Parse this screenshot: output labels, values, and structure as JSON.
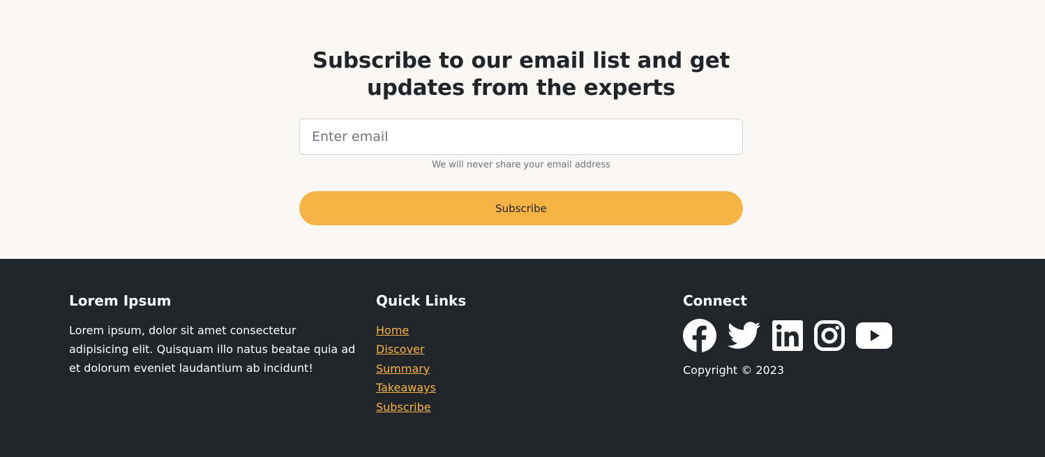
{
  "subscribe": {
    "title": "Subscribe to our email list and get updates from the experts",
    "email_placeholder": "Enter email",
    "hint": "We will never share your email address",
    "button_label": "Subscribe"
  },
  "footer": {
    "about": {
      "heading": "Lorem Ipsum",
      "text": "Lorem ipsum, dolor sit amet consectetur adipisicing elit. Quisquam illo natus beatae quia ad et dolorum eveniet laudantium ab incidunt!"
    },
    "quick_links": {
      "heading": "Quick Links",
      "items": [
        {
          "label": "Home"
        },
        {
          "label": "Discover"
        },
        {
          "label": "Summary"
        },
        {
          "label": "Takeaways"
        },
        {
          "label": "Subscribe"
        }
      ]
    },
    "connect": {
      "heading": "Connect",
      "icons": [
        "facebook-icon",
        "twitter-icon",
        "linkedin-icon",
        "instagram-icon",
        "youtube-icon"
      ],
      "copyright": "Copyright © 2023"
    }
  },
  "colors": {
    "accent": "#f7b446",
    "footer_bg": "#212429",
    "section_bg": "#faf8f5",
    "text_dark": "#212529"
  }
}
